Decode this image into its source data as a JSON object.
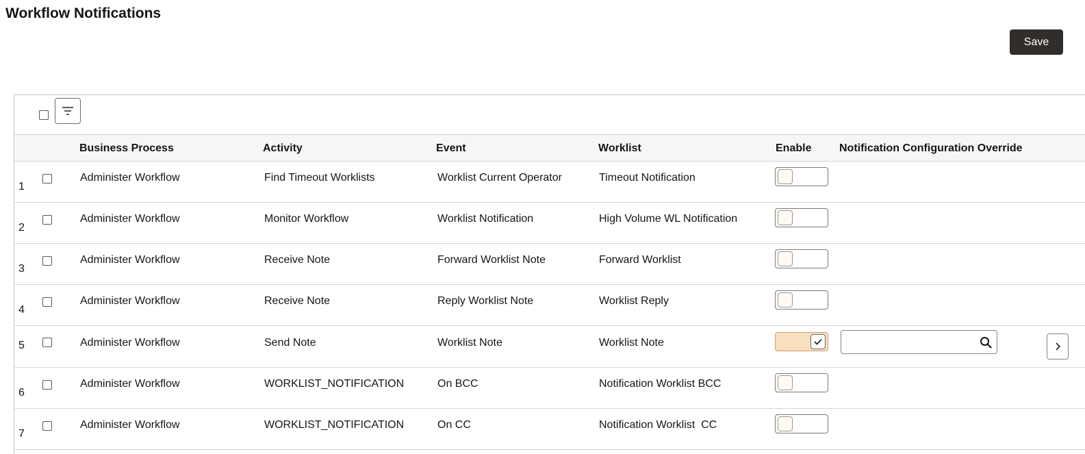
{
  "page": {
    "title": "Workflow Notifications"
  },
  "toolbar": {
    "save_label": "Save"
  },
  "grid": {
    "columns": {
      "business_process": "Business Process",
      "activity": "Activity",
      "event": "Event",
      "worklist": "Worklist",
      "enable": "Enable",
      "override": "Notification Configuration Override"
    },
    "rows": [
      {
        "number": "1",
        "business_process": "Administer Workflow",
        "activity": "Find Timeout Worklists",
        "event": "Worklist Current Operator",
        "worklist": "Timeout Notification",
        "enabled": false
      },
      {
        "number": "2",
        "business_process": "Administer Workflow",
        "activity": "Monitor Workflow",
        "event": "Worklist Notification",
        "worklist": "High Volume WL Notification",
        "enabled": false
      },
      {
        "number": "3",
        "business_process": "Administer Workflow",
        "activity": "Receive Note",
        "event": "Forward Worklist Note",
        "worklist": "Forward Worklist",
        "enabled": false
      },
      {
        "number": "4",
        "business_process": "Administer Workflow",
        "activity": "Receive Note",
        "event": "Reply Worklist Note",
        "worklist": "Worklist Reply",
        "enabled": false
      },
      {
        "number": "5",
        "business_process": "Administer Workflow",
        "activity": "Send Note",
        "event": "Worklist Note",
        "worklist": "Worklist Note",
        "enabled": true,
        "override_value": ""
      },
      {
        "number": "6",
        "business_process": "Administer Workflow",
        "activity": "WORKLIST_NOTIFICATION",
        "event": "On BCC",
        "worklist": "Notification Worklist BCC",
        "enabled": false
      },
      {
        "number": "7",
        "business_process": "Administer Workflow",
        "activity": "WORKLIST_NOTIFICATION",
        "event": "On CC",
        "worklist": "Notification Worklist  CC",
        "enabled": false
      }
    ]
  },
  "icons": {
    "filter": "filter-icon",
    "search": "search-icon",
    "check": "check-icon",
    "chevron": "chevron-right-icon"
  },
  "colors": {
    "save_button": "#312d2a",
    "toggle_on": "#f7dfc0",
    "header_bg": "#f5f7f7"
  }
}
